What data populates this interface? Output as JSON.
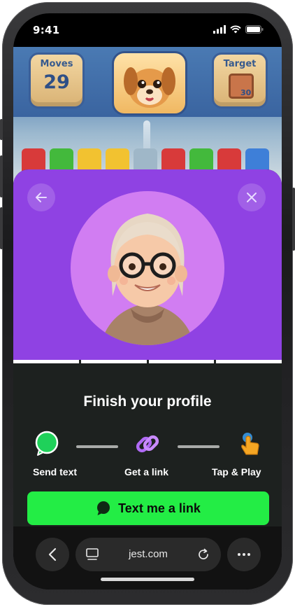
{
  "status_bar": {
    "time": "9:41"
  },
  "game": {
    "moves_label": "Moves",
    "moves_value": "29",
    "target_label": "Target",
    "target_value": "30"
  },
  "profile_sheet": {
    "title": "Finish your profile",
    "steps": [
      {
        "label": "Send text",
        "icon": "chat-bubble-icon"
      },
      {
        "label": "Get a link",
        "icon": "link-icon"
      },
      {
        "label": "Tap & Play",
        "icon": "tap-hand-icon"
      }
    ],
    "cta_label": "Text me a link",
    "colors": {
      "hero": "#8f42e3",
      "avatar_bg": "#d17df2",
      "cta": "#23ed45",
      "sheet_bg": "#1d211f"
    }
  },
  "browser": {
    "url": "jest.com"
  }
}
